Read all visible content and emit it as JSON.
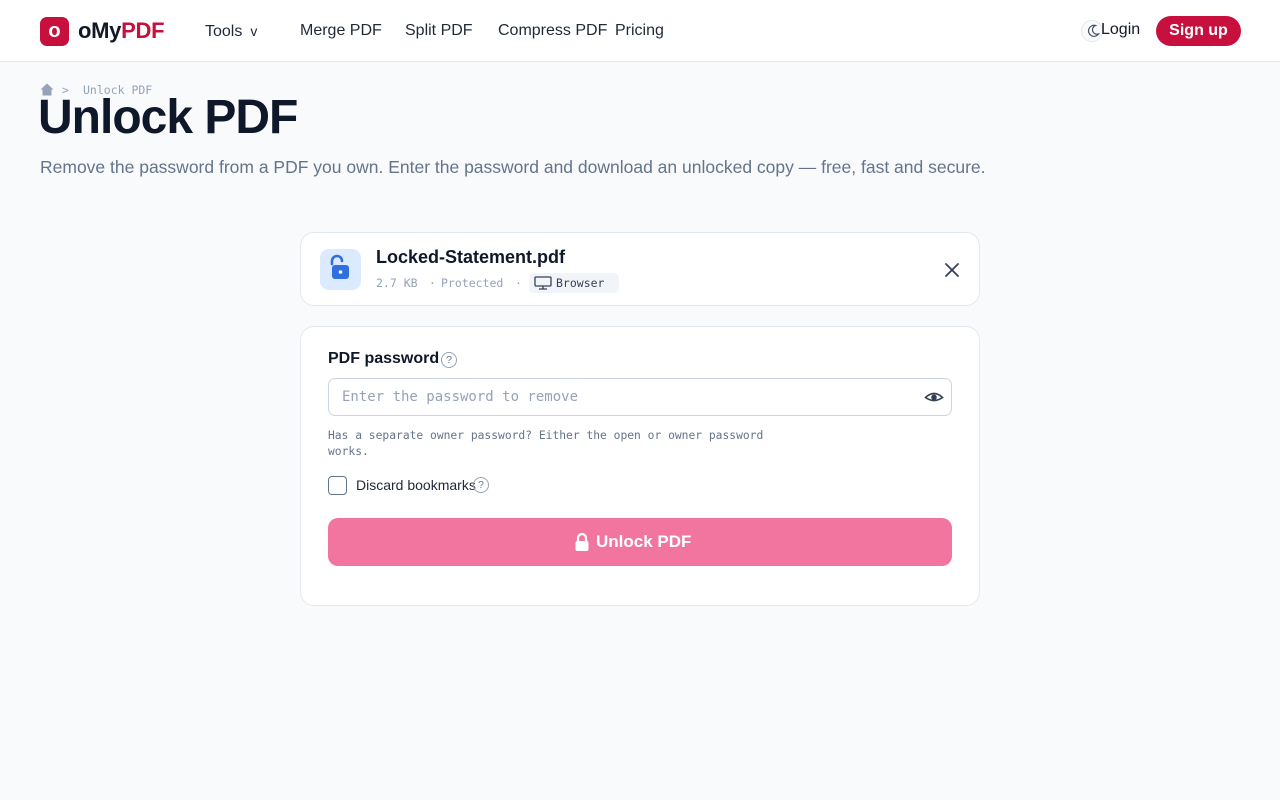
{
  "brand": {
    "mark": "o",
    "name_prefix": "oMy",
    "name_suffix": "PDF",
    "color": "#c8103e"
  },
  "nav": {
    "tools": "Tools",
    "tools_chevron": "v",
    "merge": "Merge PDF",
    "split": "Split PDF",
    "compress": "Compress PDF",
    "pricing": "Pricing"
  },
  "header_actions": {
    "theme_icon": "moon-icon",
    "login": "Login",
    "signup": "Sign up"
  },
  "breadcrumb": {
    "home_icon": "home-icon",
    "separator": ">",
    "current": "Unlock PDF"
  },
  "page": {
    "title": "Unlock PDF",
    "subtitle": "Remove the password from a PDF you own. Enter the password and download an unlocked copy — free, fast and secure."
  },
  "file": {
    "icon": "unlocked-padlock-icon",
    "name": "Locked-Statement.pdf",
    "size": "2.7 KB",
    "dot": "·",
    "status": "Protected",
    "processing_icon": "monitor-icon",
    "processing": "Browser",
    "close_icon": "close-icon"
  },
  "form": {
    "password_label": "PDF password",
    "help_icon": "?",
    "password_value": "",
    "password_placeholder": "Enter the password to remove",
    "visibility_icon": "eye-icon",
    "hint": "Has a separate owner password? Either the open or owner password works.",
    "discard_bookmarks_label": "Discard bookmarks",
    "discard_bookmarks_checked": false,
    "submit_icon": "padlock-icon",
    "submit_label": "Unlock PDF"
  },
  "colors": {
    "accent": "#c8103e",
    "button_disabled": "#f275a0",
    "page_bg": "#f8fafc",
    "file_icon_bg": "#dbeafe",
    "file_icon": "#2f6fdf"
  }
}
